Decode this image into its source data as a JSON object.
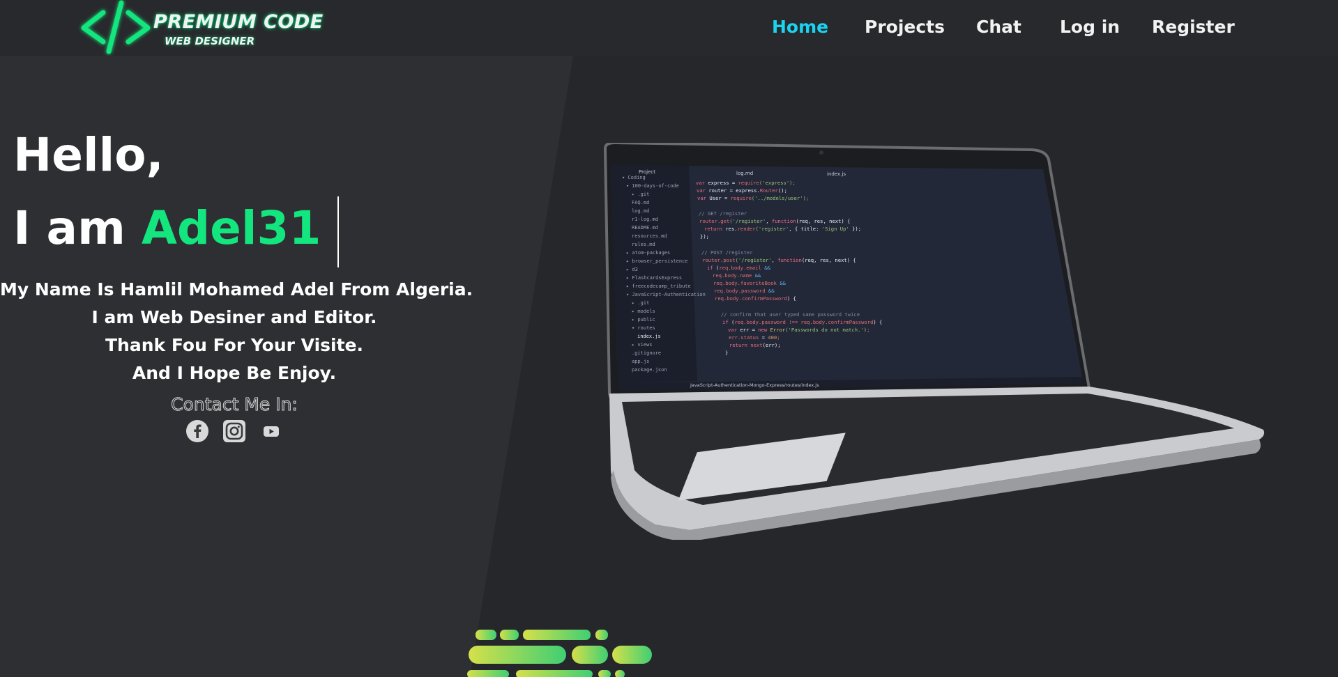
{
  "brand": {
    "title": "PREMIUM CODE",
    "subtitle": "WEB DESIGNER",
    "logo_icon": "code-brackets-icon",
    "accent_color": "#13e67e"
  },
  "nav": {
    "items": [
      {
        "label": "Home",
        "active": true
      },
      {
        "label": "Projects",
        "active": false
      },
      {
        "label": "Chat",
        "active": false
      },
      {
        "label": "Log in",
        "active": false
      },
      {
        "label": "Register",
        "active": false
      }
    ],
    "active_color": "#19d3f0"
  },
  "hero": {
    "greeting": "Hello,",
    "iam_prefix": "I am",
    "name": "Adel31",
    "bio_lines": [
      "My Name Is Hamlil Mohamed Adel From Algeria.",
      "I am Web Desiner and Editor.",
      "Thank Fou For Your Visite.",
      "And I Hope Be Enjoy."
    ],
    "contact_label": "Contact Me In:"
  },
  "socials": [
    {
      "icon": "facebook-icon"
    },
    {
      "icon": "instagram-icon"
    },
    {
      "icon": "youtube-icon"
    }
  ],
  "laptop_screen": {
    "editor_tabs": [
      "Project",
      "log.md",
      "index.js"
    ],
    "status_path": "JavaScript-Authentication-Mongo-Express/routes/index.js"
  }
}
